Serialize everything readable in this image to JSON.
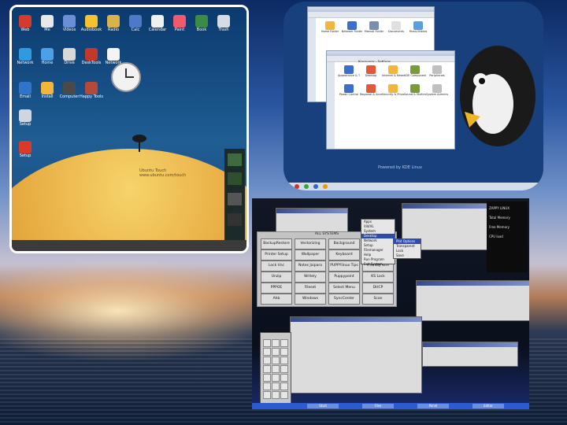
{
  "shot1": {
    "desktop_icons": [
      {
        "label": "Web",
        "icon": "globe-icon",
        "color": "#d23b2d"
      },
      {
        "label": "Me",
        "icon": "user-icon",
        "color": "#e8e8e8"
      },
      {
        "label": "Videos",
        "icon": "film-icon",
        "color": "#6a8fd6"
      },
      {
        "label": "Audiobook",
        "icon": "audio-icon",
        "color": "#f2c230"
      },
      {
        "label": "Radio",
        "icon": "radio-icon",
        "color": "#d9b34a"
      },
      {
        "label": "Calc",
        "icon": "calculator-icon",
        "color": "#4e79c7"
      },
      {
        "label": "Calendar",
        "icon": "calendar-icon",
        "color": "#f0f0f0"
      },
      {
        "label": "Paint",
        "icon": "paint-icon",
        "color": "#f05a6e"
      },
      {
        "label": "Book",
        "icon": "book-icon",
        "color": "#3c8b45"
      },
      {
        "label": "Trash",
        "icon": "trash-icon",
        "color": "#d7dbe3"
      },
      {
        "label": "Network",
        "icon": "network-icon",
        "color": "#2f9ae0"
      },
      {
        "label": "Home",
        "icon": "home-icon",
        "color": "#4ba0e8"
      },
      {
        "label": "Drive",
        "icon": "drive-icon",
        "color": "#d8d8d8"
      },
      {
        "label": "DeskTools",
        "icon": "tools-icon",
        "color": "#c0392b"
      },
      {
        "label": "Network",
        "icon": "network-icon",
        "color": "#f4f4f4"
      },
      {
        "label": "Email",
        "icon": "email-icon",
        "color": "#2e74c9"
      },
      {
        "label": "Install",
        "icon": "package-icon",
        "color": "#f2b63a"
      },
      {
        "label": "Computer",
        "icon": "computer-icon",
        "color": "#4a4a4a"
      },
      {
        "label": "Happy Tools",
        "icon": "house-icon",
        "color": "#b44a3a"
      },
      {
        "label": "Setup",
        "icon": "setup-icon",
        "color": "#cfd6e0"
      },
      {
        "label": "Setup",
        "icon": "lifebuoy-icon",
        "color": "#d93a2a"
      }
    ],
    "caption_line1": "Ubuntu Touch",
    "caption_line2": "www.ubuntu.com/touch"
  },
  "shot2": {
    "window_back_title": "Applications",
    "window_back_items": [
      "Home Folder",
      "Network Folder",
      "Manual Folder",
      "Documents",
      "Music/Videos"
    ],
    "window_front_title": "Konqueror - Settings",
    "window_front_items": [
      "Appearance & Themes",
      "Desktop",
      "Internet & Network",
      "KDE Components",
      "Peripherals",
      "Power Control",
      "Regional & Accessibility",
      "Security & Privacy",
      "Sound & Multimedia",
      "System Administration"
    ],
    "caption": "Powered by KDE Linux"
  },
  "shot3": {
    "button_panel_title": "ALL SYSTEMS",
    "buttons": [
      "BackupRestore",
      "Vectorizing",
      "Background",
      "Cut",
      "Printer Setup",
      "Wallpaper",
      "Keyboard",
      "Quick",
      "Lock Vnc",
      "Notes Jaipara",
      "PUPPYlinux Tips",
      "Friendly WiFi",
      "Unzip",
      "Writely",
      "Puppypoint",
      "KS Lock",
      "PPPOE",
      "Fileset",
      "Select Menu",
      "DHCP",
      "Ahb",
      "Windows",
      "SyncCenter",
      "Scan"
    ],
    "menu_items": [
      "Apps",
      "Vid/VL",
      "System",
      "Desktop",
      "Network",
      "Setup",
      "Filemanager",
      "Help",
      "Run Program",
      "Exit System"
    ],
    "menu_selected": "Desktop",
    "submenu_items": [
      "Plot Options",
      "Transparent",
      "Lock",
      "Save"
    ],
    "right_panel_lines": [
      "ZAPPY LINUX",
      "Total Memory",
      "Free Memory",
      "CPU load"
    ],
    "taskbar_items": [
      "Start",
      "Files",
      "Panel",
      "Editor"
    ]
  }
}
